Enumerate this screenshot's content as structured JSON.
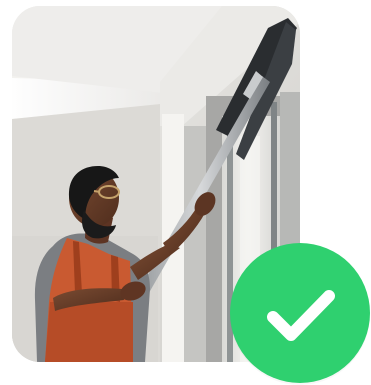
{
  "image": {
    "subject": "person-cleaning-window-with-extendable-pole",
    "has_visible_text": false
  },
  "badge": {
    "icon": "check-icon",
    "color": "#2fd06f",
    "icon_color": "#ffffff"
  }
}
